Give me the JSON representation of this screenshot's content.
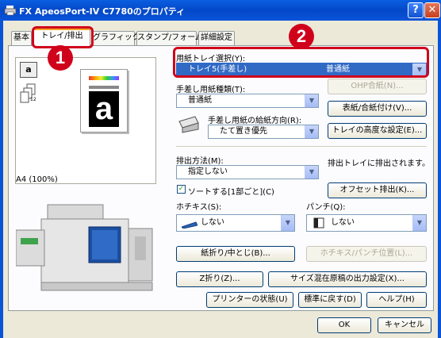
{
  "window": {
    "title": "FX ApeosPort-IV C7780のプロパティ",
    "help": "?",
    "close": "✕"
  },
  "tabs": [
    {
      "label": "基本"
    },
    {
      "label": "トレイ/排出"
    },
    {
      "label": "グラフィックス"
    },
    {
      "label": "スタンプ/フォーム"
    },
    {
      "label": "詳細設定"
    }
  ],
  "annotations": {
    "badge1": "1",
    "badge2": "2"
  },
  "preview": {
    "size_label": "A4 (100%)",
    "glyph": "a",
    "mini_a": "a",
    "mini_num": "12"
  },
  "paper_tray": {
    "label": "用紙トレイ選択(Y):",
    "value_tray": "トレイ5(手差し)",
    "value_paper": "普通紙"
  },
  "bypass": {
    "type_label": "手差し用紙種類(T):",
    "type_value": "普通紙",
    "feed_label": "手差し用紙の給紙方向(R):",
    "feed_value": "たて置き優先"
  },
  "buttons": {
    "ohp": "OHP合紙(N)...",
    "cover": "表紙/合紙付け(V)...",
    "tray_adv": "トレイの高度な設定(E)...",
    "offset": "オフセット排出(K)...",
    "fold": "紙折り/中とじ(B)...",
    "staple_pos": "ホチキス/パンチ位置(L)...",
    "zfold": "Z折り(Z)...",
    "mixed": "サイズ混在原稿の出力設定(X)...",
    "status": "プリンターの状態(U)",
    "default": "標準に戻す(D)",
    "help": "ヘルプ(H)",
    "ok": "OK",
    "cancel": "キャンセル"
  },
  "output": {
    "label": "排出方法(M):",
    "value": "指定しない",
    "note": "排出トレイに排出されます。",
    "sort_label": "ソートする[1部ごと](C)",
    "sort_checked": true
  },
  "staple": {
    "label": "ホチキス(S):",
    "value": "しない"
  },
  "punch": {
    "label": "パンチ(Q):",
    "value": "しない"
  },
  "icons": {
    "title": "printer-icon",
    "tray": "paper-tray-icon",
    "stack": "paper-stack-icon",
    "bypass": "bypass-tray-icon",
    "staple": "staple-icon",
    "punch": "punch-icon",
    "machine": "printer-machine-image"
  },
  "colors": {
    "highlight": "#d0021b",
    "selection": "#316ac5",
    "titlebar": "#0a54d8"
  }
}
